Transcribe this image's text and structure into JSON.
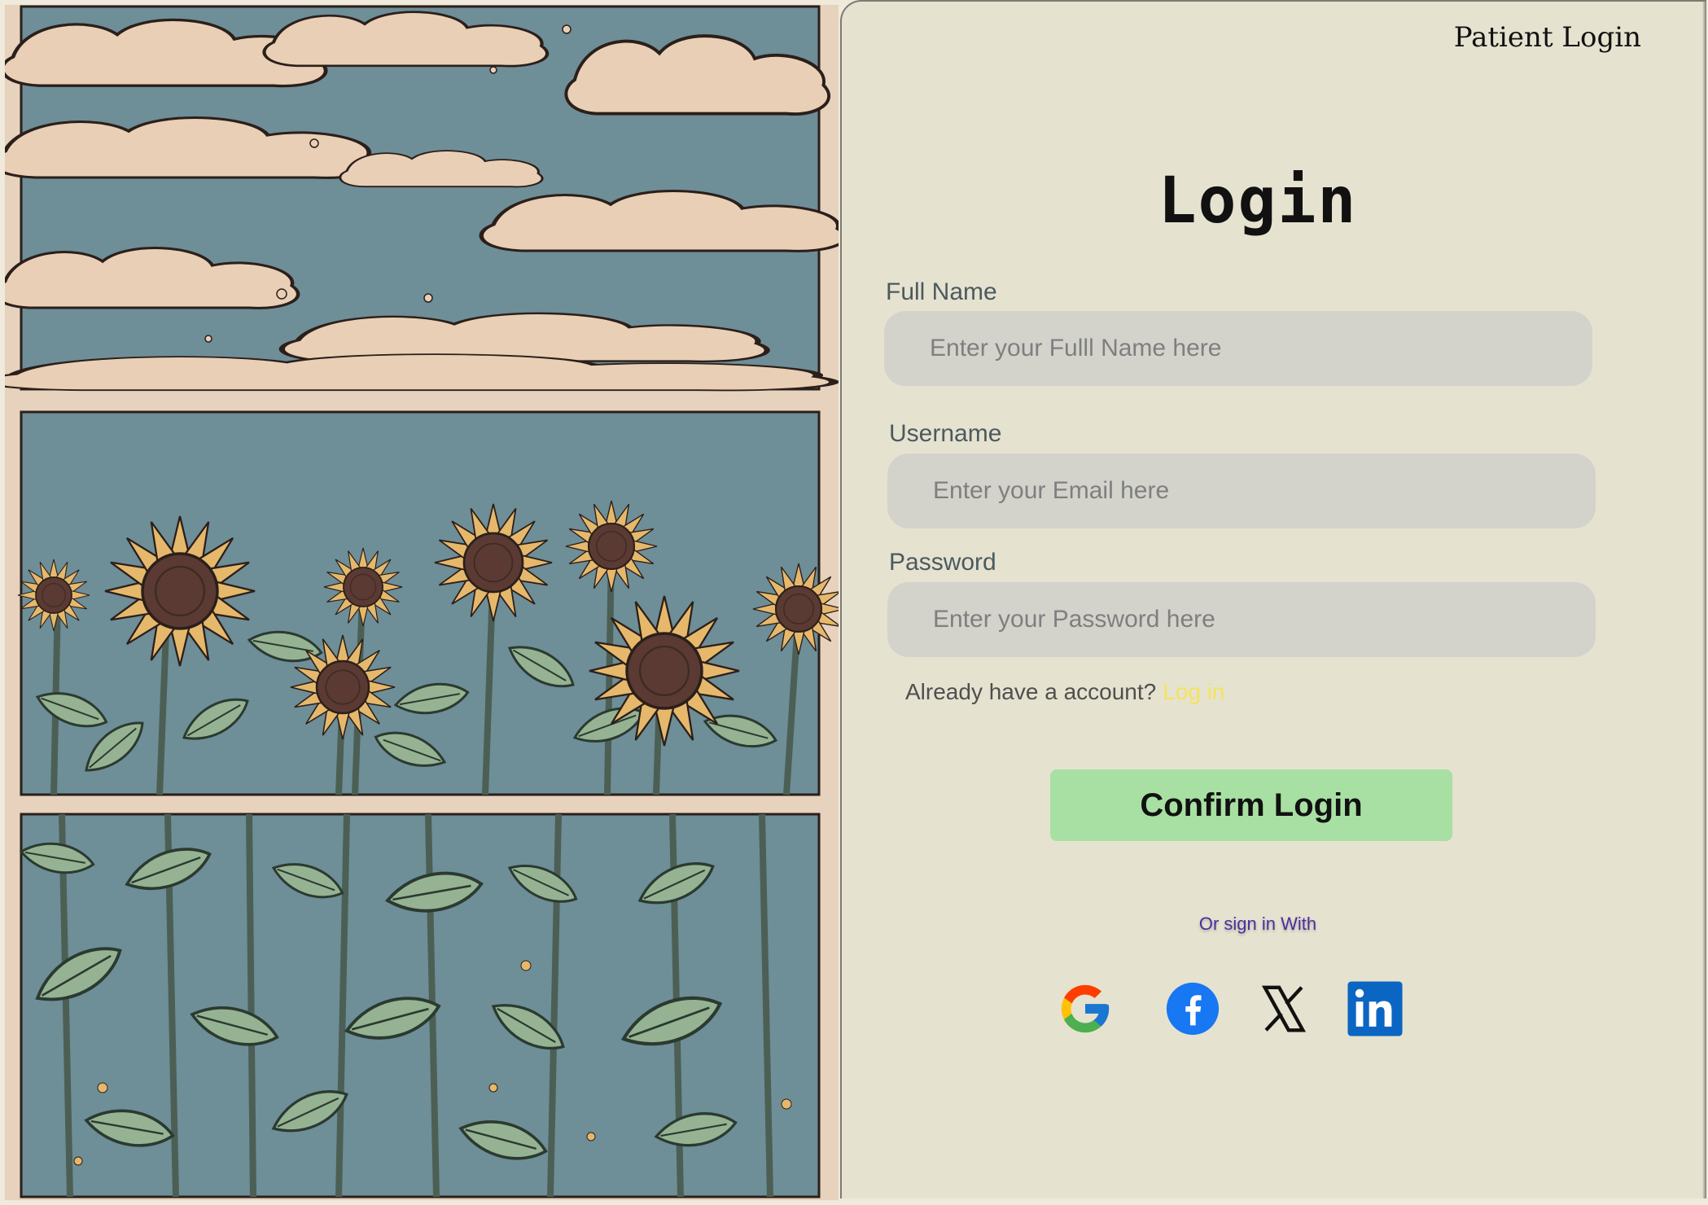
{
  "header": {
    "title": "Patient Login"
  },
  "form": {
    "title": "Login",
    "full_name": {
      "label": "Full Name",
      "placeholder": "Enter your Fulll Name here",
      "value": ""
    },
    "username": {
      "label": "Username",
      "placeholder": "Enter your Email here",
      "value": ""
    },
    "password": {
      "label": "Password",
      "placeholder": "Enter your Password here",
      "value": ""
    },
    "account_prompt": "Already have a account?",
    "account_link": "Log in",
    "confirm_label": "Confirm Login"
  },
  "social": {
    "caption": "Or sign in With",
    "providers": [
      {
        "name": "google",
        "icon": "google-icon"
      },
      {
        "name": "facebook",
        "icon": "facebook-icon"
      },
      {
        "name": "x",
        "icon": "x-icon"
      },
      {
        "name": "linkedin",
        "icon": "linkedin-icon"
      }
    ]
  },
  "illustration": {
    "subject": "sunflower field under a cloudy sky, three stacked panels",
    "colors": {
      "sky": "#6e8e98",
      "cloud": "#e9cfb5",
      "petal": "#e6b86b",
      "center": "#5a3a33",
      "leaf": "#95b392",
      "stem": "#4c5f54"
    }
  },
  "theme": {
    "card_bg": "#e6e2d0",
    "button_green": "#a8e0a3",
    "link_yellow": "#f3e45c",
    "caption_purple": "#4b2fa0"
  }
}
